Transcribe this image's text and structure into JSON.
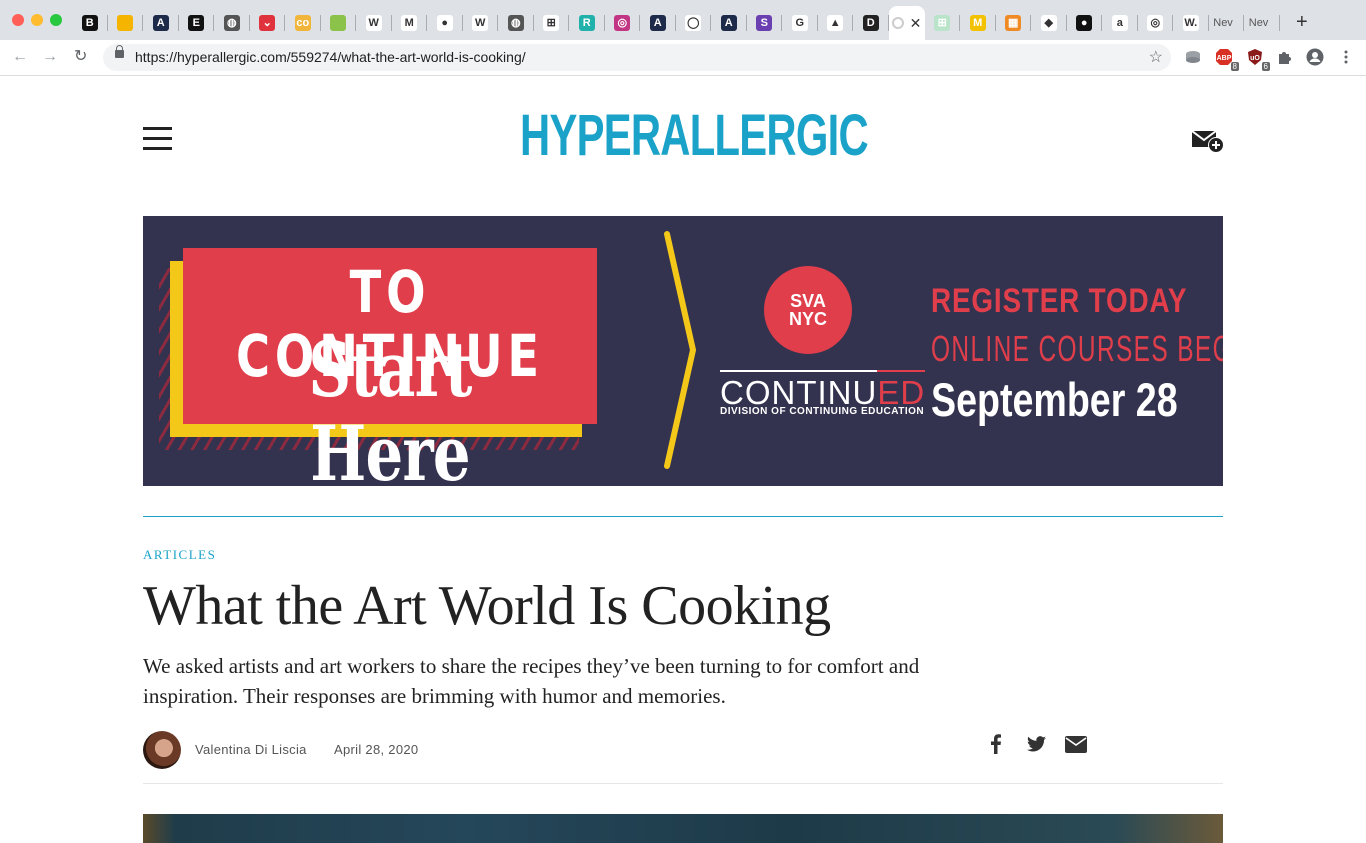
{
  "browser": {
    "tabs": [
      {
        "icon": "b-icon",
        "glyph": "B",
        "bg": "#111111"
      },
      {
        "icon": "slides-icon",
        "glyph": "",
        "bg": "#f4b400"
      },
      {
        "icon": "arrow-logo-icon",
        "glyph": "A",
        "bg": "#1e2a4a"
      },
      {
        "icon": "e-icon",
        "glyph": "E",
        "bg": "#111111"
      },
      {
        "icon": "globe-icon",
        "glyph": "◍",
        "bg": "#555555"
      },
      {
        "icon": "pocket-icon",
        "glyph": "⌄",
        "bg": "#e0323c"
      },
      {
        "icon": "cc-icon",
        "glyph": "co",
        "bg": "#f2b53b"
      },
      {
        "icon": "leaf-icon",
        "glyph": "",
        "bg": "#8bc34a"
      },
      {
        "icon": "wikipedia-icon",
        "glyph": "W",
        "bg": "#ffffff"
      },
      {
        "icon": "medium-icon",
        "glyph": "M",
        "bg": "#ffffff"
      },
      {
        "icon": "planet-icon",
        "glyph": "●",
        "bg": "#ffffff"
      },
      {
        "icon": "wikipedia-icon",
        "glyph": "W",
        "bg": "#ffffff"
      },
      {
        "icon": "globe-icon",
        "glyph": "◍",
        "bg": "#555555"
      },
      {
        "icon": "board-icon",
        "glyph": "⊞",
        "bg": "#ffffff"
      },
      {
        "icon": "r-icon",
        "glyph": "R",
        "bg": "#20b2aa"
      },
      {
        "icon": "instagram-icon",
        "glyph": "◎",
        "bg": "#c13584"
      },
      {
        "icon": "arrow-logo-icon",
        "glyph": "A",
        "bg": "#1e2a4a"
      },
      {
        "icon": "drop-icon",
        "glyph": "◯",
        "bg": "#ffffff"
      },
      {
        "icon": "arrow-logo-icon",
        "glyph": "A",
        "bg": "#1e2a4a"
      },
      {
        "icon": "s-icon",
        "glyph": "S",
        "bg": "#6a3fb0"
      },
      {
        "icon": "google-icon",
        "glyph": "G",
        "bg": "#ffffff"
      },
      {
        "icon": "drive-icon",
        "glyph": "▲",
        "bg": "#ffffff"
      },
      {
        "icon": "d-icon",
        "glyph": "D",
        "bg": "#222222"
      },
      {
        "icon": "loading-icon",
        "glyph": "",
        "bg": "#ffffff",
        "active": true
      },
      {
        "icon": "sheet-icon",
        "glyph": "⊞",
        "bg": "#b9e4c9"
      },
      {
        "icon": "m-icon",
        "glyph": "M",
        "bg": "#f2c200"
      },
      {
        "icon": "grid-icon",
        "glyph": "▦",
        "bg": "#f08a24"
      },
      {
        "icon": "diamond-icon",
        "glyph": "◆",
        "bg": "#ffffff"
      },
      {
        "icon": "circle-logo-icon",
        "glyph": "●",
        "bg": "#111111"
      },
      {
        "icon": "amazon-icon",
        "glyph": "a",
        "bg": "#ffffff"
      },
      {
        "icon": "target-icon",
        "glyph": "◎",
        "bg": "#ffffff"
      },
      {
        "icon": "w-icon",
        "glyph": "W.",
        "bg": "#ffffff"
      },
      {
        "icon": "",
        "glyph": "",
        "text": "Nev"
      },
      {
        "icon": "",
        "glyph": "",
        "text": "Nev"
      }
    ],
    "url": "https://hyperallergic.com/559274/what-the-art-world-is-cooking/",
    "extensions": [
      {
        "name": "extension-icon",
        "badge": ""
      },
      {
        "name": "adblock-icon",
        "badge": "8"
      },
      {
        "name": "ublock-icon",
        "badge": "6"
      },
      {
        "name": "puzzle-icon",
        "badge": ""
      },
      {
        "name": "profile-icon",
        "badge": ""
      },
      {
        "name": "menu-icon",
        "badge": ""
      }
    ]
  },
  "site": {
    "logo": "HYPERALLERGIC",
    "brand_color": "#1aa2c8"
  },
  "ad": {
    "line1": "TO CONTINUE",
    "line2": "Start Here",
    "badge_line1": "SVA",
    "badge_line2": "NYC",
    "brand_main": "CONTINU",
    "brand_ed": "ED",
    "brand_sub": "DIVISION OF CONTINUING EDUCATION",
    "register": "REGISTER TODAY",
    "courses": "ONLINE COURSES BEGIN",
    "date": "September 28",
    "colors": {
      "background": "#34334f",
      "red": "#e03e4b",
      "yellow": "#f4c819"
    }
  },
  "article": {
    "category": "ARTICLES",
    "title": "What the Art World Is Cooking",
    "dek": "We asked artists and art workers to share the recipes they’ve been turning to for comfort and inspiration. Their responses are brimming with humor and memories.",
    "author": "Valentina Di Liscia",
    "date": "April 28, 2020"
  }
}
